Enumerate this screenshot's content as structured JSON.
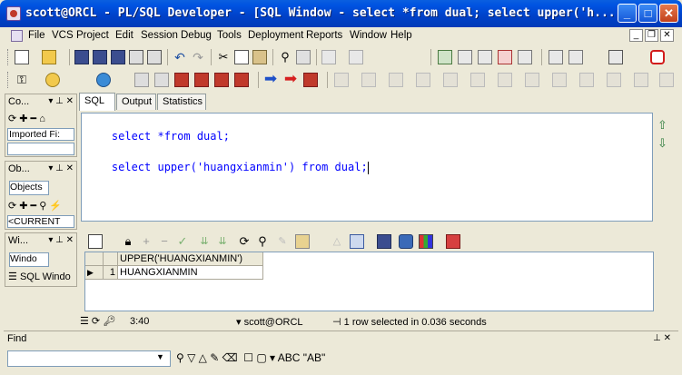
{
  "window": {
    "title": "scott@ORCL - PL/SQL Developer - [SQL Window - select *from dual; select upper('h..."
  },
  "menu": [
    "File",
    "VCS",
    "Project",
    "Edit",
    "Session",
    "Debug",
    "Tools",
    "Deployment",
    "Reports",
    "Window",
    "Help"
  ],
  "left_panels": {
    "top_label": "Co...",
    "imported_label": "Imported Fi:",
    "objects_label": "Ob...",
    "objects_tab": "Objects",
    "current_user": "<CURRENT",
    "windows_label": "Wi...",
    "windows_tab": "Windo",
    "window_item": "SQL Windo"
  },
  "tabs": [
    "SQL",
    "Output",
    "Statistics"
  ],
  "editor": {
    "line1": "select *from dual;",
    "line2": "select upper('huangxianmin') from dual;"
  },
  "results": {
    "column_header": "UPPER('HUANGXIANMIN')",
    "row_number": "1",
    "row_value": "HUANGXIANMIN"
  },
  "status": {
    "time": "3:40",
    "connection": "scott@ORCL",
    "message": "1 row selected in 0.036 seconds"
  },
  "find": {
    "label": "Find",
    "text_abc": "ABC",
    "text_quoted": "\"AB\""
  }
}
